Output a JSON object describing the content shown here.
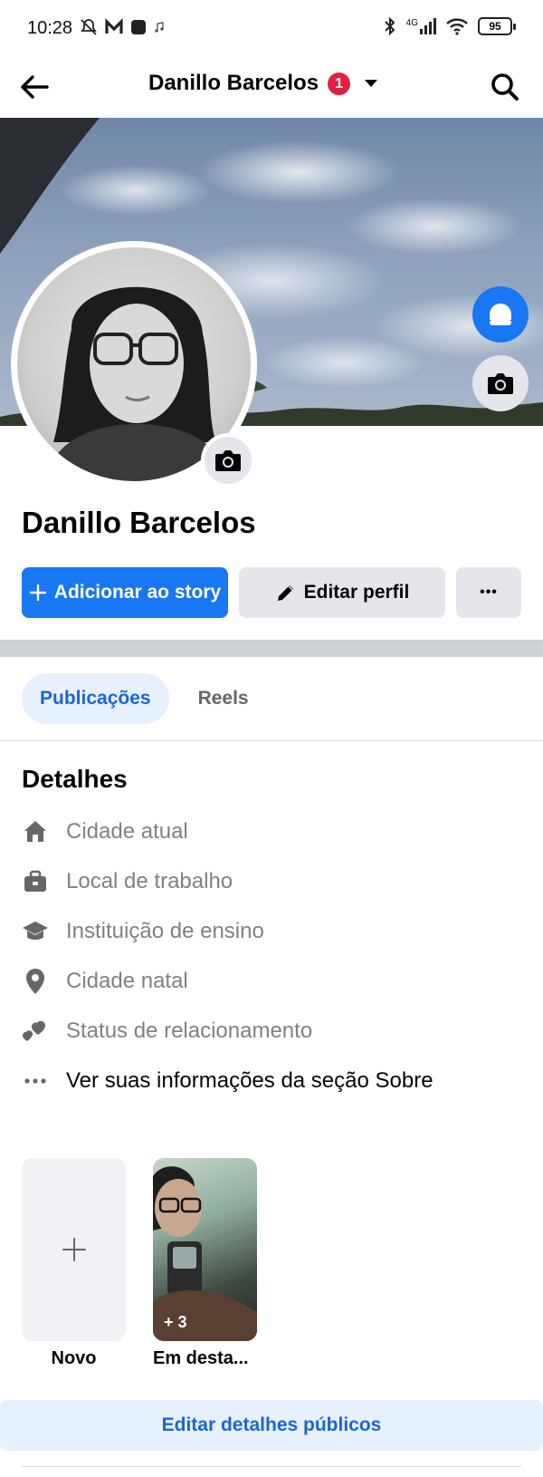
{
  "status_bar": {
    "time": "10:28",
    "network": "4G",
    "battery": "95"
  },
  "header": {
    "title": "Danillo Barcelos",
    "badge_count": "1"
  },
  "profile": {
    "name": "Danillo Barcelos"
  },
  "actions": {
    "add_story": "Adicionar ao story",
    "edit_profile": "Editar perfil",
    "more": "•••"
  },
  "tabs": [
    {
      "label": "Publicações",
      "active": true
    },
    {
      "label": "Reels",
      "active": false
    }
  ],
  "details": {
    "title": "Detalhes",
    "items": [
      {
        "icon": "home-icon",
        "label": "Cidade atual"
      },
      {
        "icon": "briefcase-icon",
        "label": "Local de trabalho"
      },
      {
        "icon": "graduation-cap-icon",
        "label": "Instituição de ensino"
      },
      {
        "icon": "location-pin-icon",
        "label": "Cidade natal"
      },
      {
        "icon": "hearts-icon",
        "label": "Status de relacionamento"
      },
      {
        "icon": "more-dots-icon",
        "label": "Ver suas informações da seção Sobre"
      }
    ]
  },
  "highlights": {
    "new_label": "Novo",
    "featured_label": "Em desta...",
    "featured_count": "+ 3"
  },
  "edit_public_details": "Editar detalhes públicos",
  "colors": {
    "brand_blue": "#1877f2",
    "light_blue": "#e7f0fd",
    "button_gray": "#e4e6eb",
    "badge_red": "#e41e3f"
  }
}
